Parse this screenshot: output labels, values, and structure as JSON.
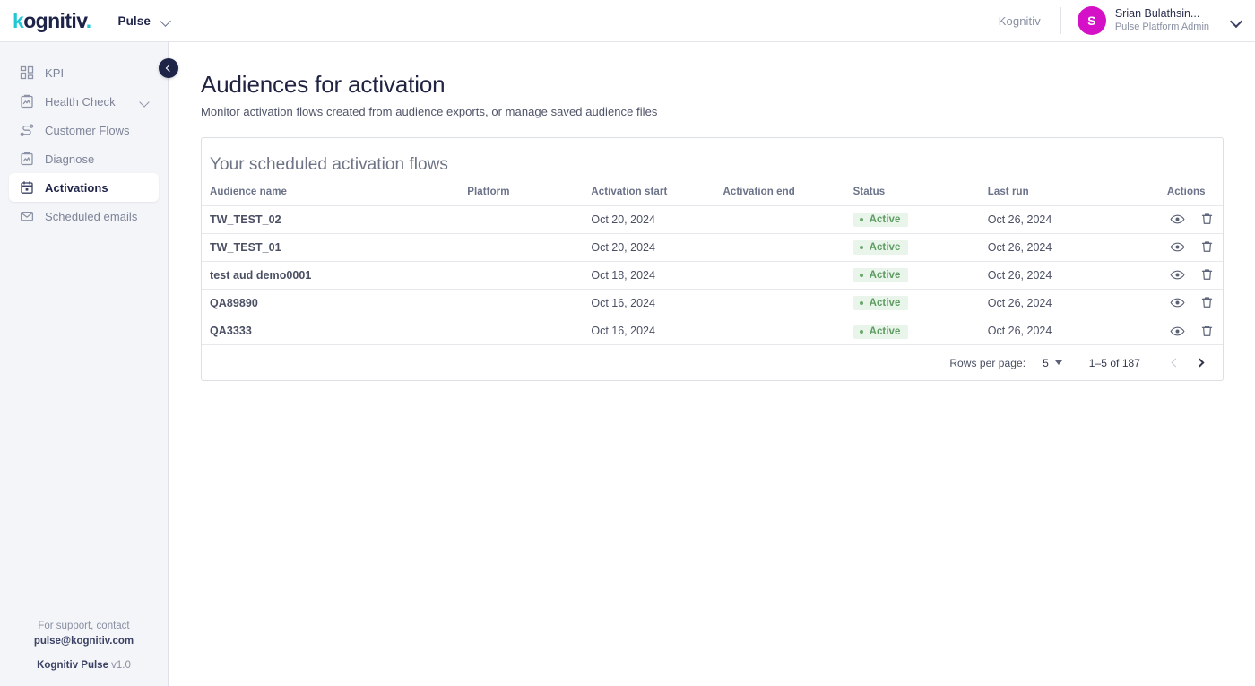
{
  "topbar": {
    "logo": {
      "prefix": "k",
      "middle": "ognitiv",
      "dot": "."
    },
    "brand_label": "Pulse",
    "brand_chevron_icon": "chevron-down-icon",
    "org_name": "Kognitiv",
    "user": {
      "avatar_initial": "S",
      "avatar_color": "#d411c6",
      "name": "Srian Bulathsin...",
      "role": "Pulse Platform Admin",
      "chevron_icon": "chevron-down-icon"
    }
  },
  "sidebar": {
    "collapse_button_icon": "chevron-left-icon",
    "items": [
      {
        "label": "KPI",
        "icon": "dashboard-grid-icon",
        "active": false,
        "expandable": false
      },
      {
        "label": "Health Check",
        "icon": "clipboard-chart-icon",
        "active": false,
        "expandable": true
      },
      {
        "label": "Customer Flows",
        "icon": "flow-path-icon",
        "active": false,
        "expandable": false
      },
      {
        "label": "Diagnose",
        "icon": "clipboard-chart-icon",
        "active": false,
        "expandable": false
      },
      {
        "label": "Activations",
        "icon": "calendar-icon",
        "active": true,
        "expandable": false
      },
      {
        "label": "Scheduled emails",
        "icon": "envelope-icon",
        "active": false,
        "expandable": false
      }
    ],
    "footer": {
      "support_line": "For support, contact",
      "support_email": "pulse@kognitiv.com",
      "product_name": "Kognitiv Pulse",
      "version": " v1.0"
    }
  },
  "main": {
    "page_title": "Audiences for activation",
    "page_subtitle": "Monitor activation flows created from audience exports, or manage saved audience files",
    "card_title": "Your scheduled activation flows",
    "table": {
      "columns": [
        "Audience name",
        "Platform",
        "Activation start",
        "Activation end",
        "Status",
        "Last run",
        "Actions"
      ],
      "rows": [
        {
          "audience_name": "TW_TEST_02",
          "platform": "",
          "activation_start": "Oct 20, 2024",
          "activation_end": "",
          "status": "Active",
          "last_run": "Oct 26, 2024",
          "actions": [
            "view-icon",
            "delete-icon"
          ]
        },
        {
          "audience_name": "TW_TEST_01",
          "platform": "",
          "activation_start": "Oct 20, 2024",
          "activation_end": "",
          "status": "Active",
          "last_run": "Oct 26, 2024",
          "actions": [
            "view-icon",
            "delete-icon"
          ]
        },
        {
          "audience_name": "test aud demo0001",
          "platform": "",
          "activation_start": "Oct 18, 2024",
          "activation_end": "",
          "status": "Active",
          "last_run": "Oct 26, 2024",
          "actions": [
            "view-icon",
            "delete-icon"
          ]
        },
        {
          "audience_name": "QA89890",
          "platform": "",
          "activation_start": "Oct 16, 2024",
          "activation_end": "",
          "status": "Active",
          "last_run": "Oct 26, 2024",
          "actions": [
            "view-icon",
            "delete-icon"
          ]
        },
        {
          "audience_name": "QA3333",
          "platform": "",
          "activation_start": "Oct 16, 2024",
          "activation_end": "",
          "status": "Active",
          "last_run": "Oct 26, 2024",
          "actions": [
            "view-icon",
            "delete-icon"
          ]
        }
      ]
    },
    "pagination": {
      "rows_per_page_label": "Rows per page:",
      "rows_per_page_value": "5",
      "range_label": "1–5 of 187",
      "prev_icon": "chevron-left-icon",
      "next_icon": "chevron-right-icon",
      "prev_disabled": true,
      "next_disabled": false
    }
  },
  "colors": {
    "brand_navy": "#1e2348",
    "brand_cyan": "#21c8d4",
    "avatar_magenta": "#d411c6",
    "status_green_text": "#5e9c61",
    "status_green_bg": "#e9f4ea",
    "sidebar_bg": "#f4f5f8"
  }
}
